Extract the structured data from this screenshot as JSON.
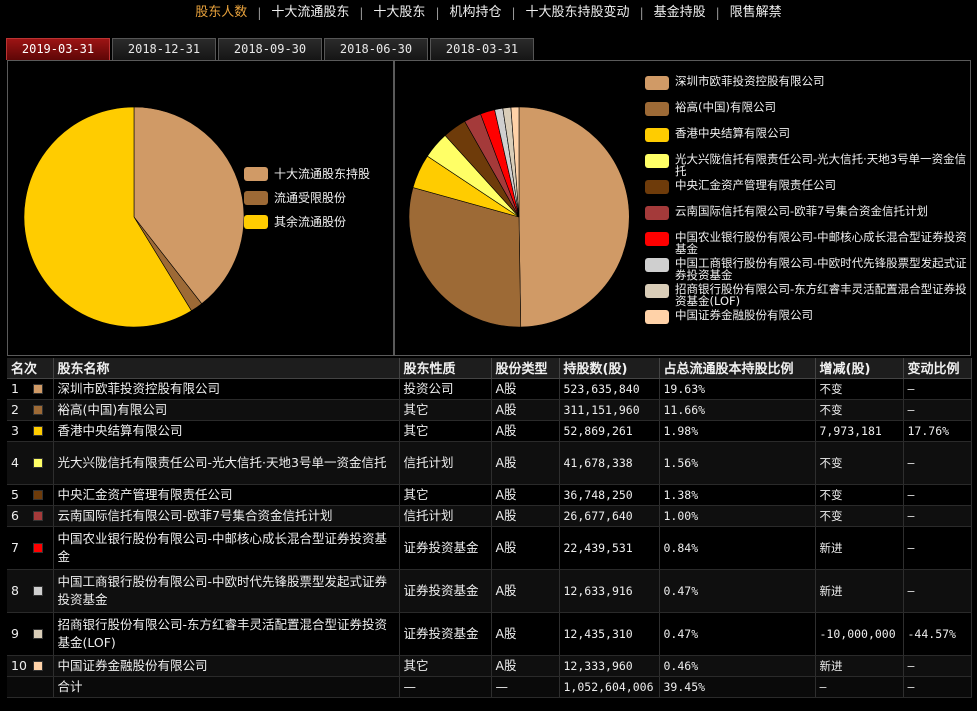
{
  "nav": {
    "items": [
      "股东人数",
      "十大流通股东",
      "十大股东",
      "机构持仓",
      "十大股东持股变动",
      "基金持股",
      "限售解禁"
    ],
    "active_index": 0,
    "active_color": "#e8a23c"
  },
  "tabs": {
    "items": [
      "2019-03-31",
      "2018-12-31",
      "2018-09-30",
      "2018-06-30",
      "2018-03-31"
    ],
    "active_index": 0
  },
  "chart_data": [
    {
      "type": "pie",
      "labels": [
        "十大流通股东持股",
        "流通受限股份",
        "其余流通股份"
      ],
      "values": [
        39.45,
        1.8,
        58.75
      ],
      "colors": [
        "#d09a66",
        "#9d6a36",
        "#ffcc00"
      ],
      "legend": "right"
    },
    {
      "type": "pie",
      "labels": [
        "深圳市欧菲投资控股有限公司",
        "裕高(中国)有限公司",
        "香港中央结算有限公司",
        "光大兴陇信托有限责任公司-光大信托·天地3号单一资金信托",
        "中央汇金资产管理有限责任公司",
        "云南国际信托有限公司-欧菲7号集合资金信托计划",
        "中国农业银行股份有限公司-中邮核心成长混合型证券投资基金",
        "中国工商银行股份有限公司-中欧时代先锋股票型发起式证券投资基金",
        "招商银行股份有限公司-东方红睿丰灵活配置混合型证券投资基金(LOF)",
        "中国证券金融股份有限公司"
      ],
      "values": [
        523635840,
        311151960,
        52869261,
        41678338,
        36748250,
        26677640,
        22439531,
        12633916,
        12435310,
        12333960
      ],
      "colors": [
        "#d09a66",
        "#9d6a36",
        "#ffcc00",
        "#ffff66",
        "#6e3b0a",
        "#a43a3a",
        "#ff0000",
        "#cfcfcf",
        "#d9cdb8",
        "#ffd2a8"
      ],
      "legend": "right"
    }
  ],
  "table": {
    "headers": [
      "名次",
      "股东名称",
      "股东性质",
      "股份类型",
      "持股数(股)",
      "占总流通股本持股比例",
      "增减(股)",
      "变动比例"
    ],
    "rows": [
      {
        "rank": "1",
        "color": "#d09a66",
        "name": "深圳市欧菲投资控股有限公司",
        "nature": "投资公司",
        "type": "A股",
        "shares": "523,635,840",
        "ratio": "19.63%",
        "change": "不变",
        "change_ratio": "—"
      },
      {
        "rank": "2",
        "color": "#9d6a36",
        "name": "裕高(中国)有限公司",
        "nature": "其它",
        "type": "A股",
        "shares": "311,151,960",
        "ratio": "11.66%",
        "change": "不变",
        "change_ratio": "—"
      },
      {
        "rank": "3",
        "color": "#ffcc00",
        "name": "香港中央结算有限公司",
        "nature": "其它",
        "type": "A股",
        "shares": "52,869,261",
        "ratio": "1.98%",
        "change": "7,973,181",
        "change_ratio": "17.76%"
      },
      {
        "rank": "4",
        "color": "#ffff66",
        "name": "光大兴陇信托有限责任公司-光大信托·天地3号单一资金信托",
        "nature": "信托计划",
        "type": "A股",
        "shares": "41,678,338",
        "ratio": "1.56%",
        "change": "不变",
        "change_ratio": "—"
      },
      {
        "rank": "5",
        "color": "#6e3b0a",
        "name": "中央汇金资产管理有限责任公司",
        "nature": "其它",
        "type": "A股",
        "shares": "36,748,250",
        "ratio": "1.38%",
        "change": "不变",
        "change_ratio": "—"
      },
      {
        "rank": "6",
        "color": "#a43a3a",
        "name": "云南国际信托有限公司-欧菲7号集合资金信托计划",
        "nature": "信托计划",
        "type": "A股",
        "shares": "26,677,640",
        "ratio": "1.00%",
        "change": "不变",
        "change_ratio": "—"
      },
      {
        "rank": "7",
        "color": "#ff0000",
        "name": "中国农业银行股份有限公司-中邮核心成长混合型证券投资基金",
        "nature": "证券投资基金",
        "type": "A股",
        "shares": "22,439,531",
        "ratio": "0.84%",
        "change": "新进",
        "change_ratio": "—"
      },
      {
        "rank": "8",
        "color": "#cfcfcf",
        "name": "中国工商银行股份有限公司-中欧时代先锋股票型发起式证券投资基金",
        "nature": "证券投资基金",
        "type": "A股",
        "shares": "12,633,916",
        "ratio": "0.47%",
        "change": "新进",
        "change_ratio": "—"
      },
      {
        "rank": "9",
        "color": "#d9cdb8",
        "name": "招商银行股份有限公司-东方红睿丰灵活配置混合型证券投资基金(LOF)",
        "nature": "证券投资基金",
        "type": "A股",
        "shares": "12,435,310",
        "ratio": "0.47%",
        "change": "-10,000,000",
        "change_ratio": "-44.57%"
      },
      {
        "rank": "10",
        "color": "#ffd2a8",
        "name": "中国证券金融股份有限公司",
        "nature": "其它",
        "type": "A股",
        "shares": "12,333,960",
        "ratio": "0.46%",
        "change": "新进",
        "change_ratio": "—"
      }
    ],
    "total": {
      "label": "合计",
      "nature": "—",
      "type": "—",
      "shares": "1,052,604,006",
      "ratio": "39.45%",
      "change": "—",
      "change_ratio": "—"
    }
  }
}
